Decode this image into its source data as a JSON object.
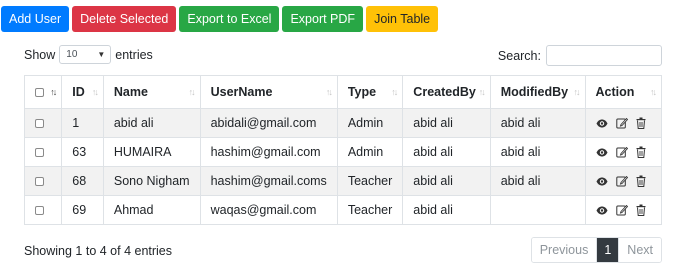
{
  "toolbar": {
    "add_user": "Add User",
    "delete_selected": "Delete Selected",
    "export_excel": "Export to Excel",
    "export_pdf": "Export PDF",
    "join_table": "Join Table"
  },
  "length_menu": {
    "show_label": "Show",
    "selected_value": "10",
    "entries_label": "entries"
  },
  "search": {
    "label": "Search:",
    "value": ""
  },
  "table": {
    "columns": [
      "",
      "ID",
      "Name",
      "UserName",
      "Type",
      "CreatedBy",
      "ModifiedBy",
      "Action"
    ],
    "rows": [
      {
        "id": "1",
        "name": "abid ali",
        "username": "abidali@gmail.com",
        "type": "Admin",
        "created_by": "abid ali",
        "modified_by": "abid ali"
      },
      {
        "id": "63",
        "name": "HUMAIRA",
        "username": "hashim@gmail.com",
        "type": "Admin",
        "created_by": "abid ali",
        "modified_by": "abid ali"
      },
      {
        "id": "68",
        "name": "Sono Nigham",
        "username": "hashim@gmail.coms",
        "type": "Teacher",
        "created_by": "abid ali",
        "modified_by": "abid ali"
      },
      {
        "id": "69",
        "name": "Ahmad",
        "username": "waqas@gmail.com",
        "type": "Teacher",
        "created_by": "abid ali",
        "modified_by": ""
      }
    ]
  },
  "footer": {
    "info": "Showing 1 to 4 of 4 entries"
  },
  "pagination": {
    "previous": "Previous",
    "current_page": "1",
    "next": "Next"
  },
  "colors": {
    "primary": "#007bff",
    "danger": "#dc3545",
    "success": "#28a745",
    "warning": "#ffc107",
    "pager_active": "#343a40"
  },
  "icons": {
    "view": "eye-icon",
    "edit": "edit-icon",
    "delete": "trash-icon"
  }
}
